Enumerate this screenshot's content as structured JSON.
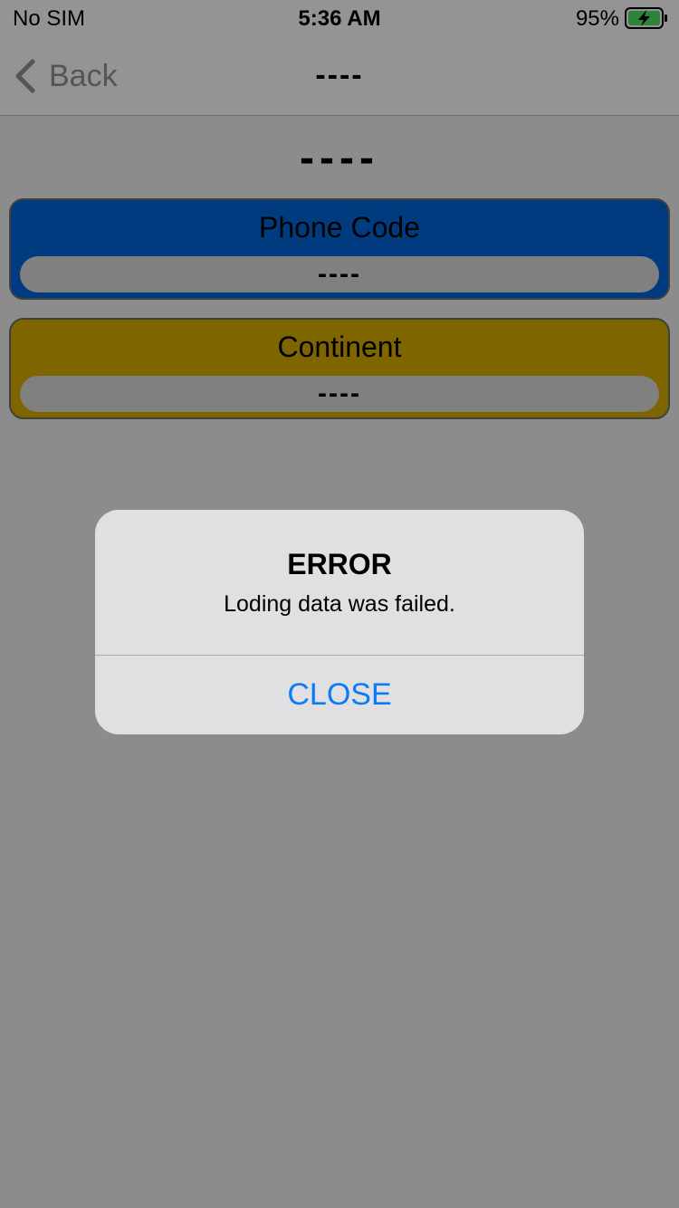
{
  "status_bar": {
    "carrier": "No SIM",
    "time": "5:36 AM",
    "battery_percent": "95%",
    "battery_icon": "battery-charging-icon"
  },
  "nav": {
    "back_label": "Back",
    "back_icon": "chevron-left-icon",
    "title": "----"
  },
  "main": {
    "title": "----",
    "cards": [
      {
        "label": "Phone Code",
        "value": "----",
        "color": "#0063d6"
      },
      {
        "label": "Continent",
        "value": "----",
        "color": "#d4a800"
      }
    ]
  },
  "alert": {
    "title": "ERROR",
    "message": "Loding data was failed.",
    "button_label": "CLOSE",
    "button_color": "#0a7cf7"
  }
}
